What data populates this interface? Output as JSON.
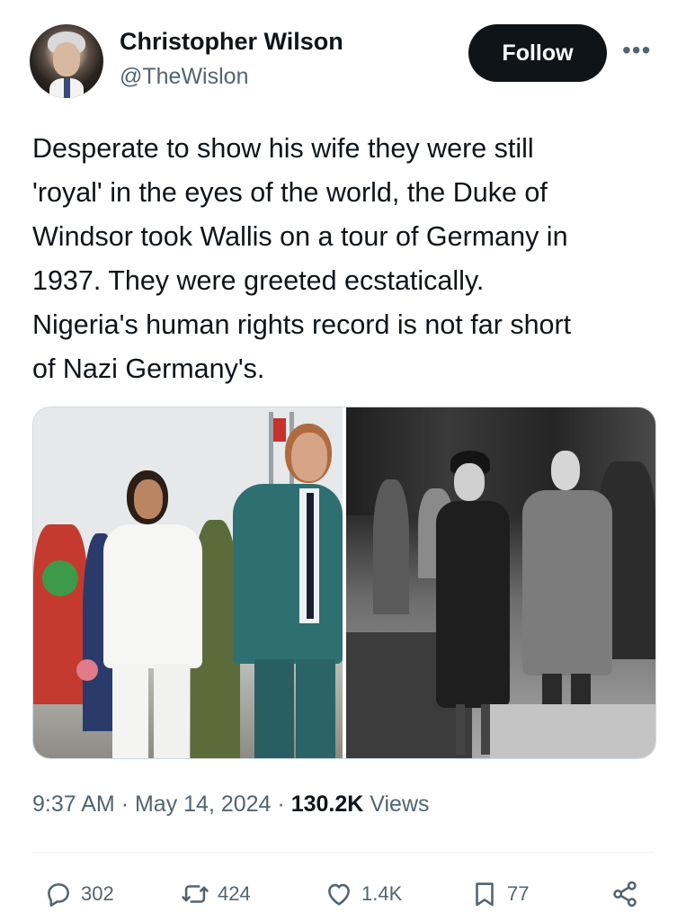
{
  "author": {
    "name": "Christopher Wilson",
    "handle": "@TheWislon",
    "follow_label": "Follow"
  },
  "more_menu": "•••",
  "tweet_lines": [
    "Desperate to show his wife they were still",
    "'royal' in the eyes of the world, the Duke of",
    "Windsor took Wallis on a tour of Germany in",
    "1937. They were greeted ecstatically.",
    "Nigeria's human rights record is not far short",
    "of Nazi Germany's."
  ],
  "meta": {
    "time": "9:37 AM",
    "date": "May 14, 2024",
    "views_count": "130.2K",
    "views_label": "Views"
  },
  "actions": {
    "replies": "302",
    "reposts": "424",
    "likes": "1.4K",
    "bookmarks": "77"
  },
  "icons": [
    "reply-icon",
    "repost-icon",
    "like-icon",
    "bookmark-icon",
    "share-icon"
  ],
  "colors": {
    "text": "#0f1419",
    "secondary": "#536471",
    "follow_bg": "#0f1419"
  }
}
